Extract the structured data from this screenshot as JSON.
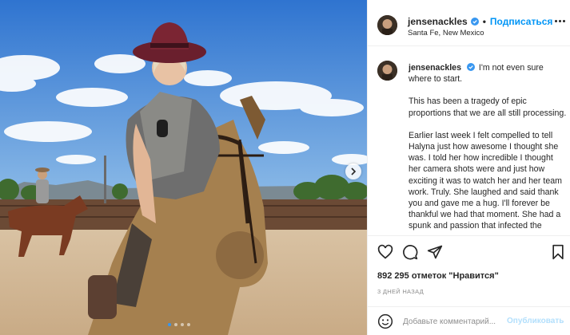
{
  "post": {
    "username": "jensenackles",
    "verified": true,
    "separator": "•",
    "follow_label": "Подписаться",
    "location": "Santa Fe, New Mexico",
    "caption_paragraphs": [
      "I'm not even sure where to start.",
      "This has been a tragedy of epic proportions that we are all still processing.",
      "Earlier last week I felt compelled to tell Halyna just how awesome I thought she was. I told her how incredible I thought her camera shots were and just how exciting it was to watch her and her team work. Truly. She laughed and said thank you and gave me a hug. I'll forever be thankful we had that moment.  She had a spunk and passion that infected the"
    ],
    "likes_text": "892 295 отметок \"Нравится\"",
    "time_text": "3 ДНЕЙ НАЗАД",
    "comment_placeholder": "Добавьте комментарий...",
    "post_button_label": "Опубликовать",
    "carousel": {
      "total": 4,
      "active": 0
    }
  },
  "icons": [
    "more-options-icon",
    "verified-badge-icon",
    "heart-icon",
    "comment-icon",
    "share-icon",
    "bookmark-icon",
    "emoji-icon",
    "chevron-right-icon"
  ],
  "colors": {
    "accent": "#0095f6",
    "verified": "#3897f0",
    "text": "#262626",
    "muted": "#8e8e8e",
    "post_disabled": "#b2dffc"
  }
}
